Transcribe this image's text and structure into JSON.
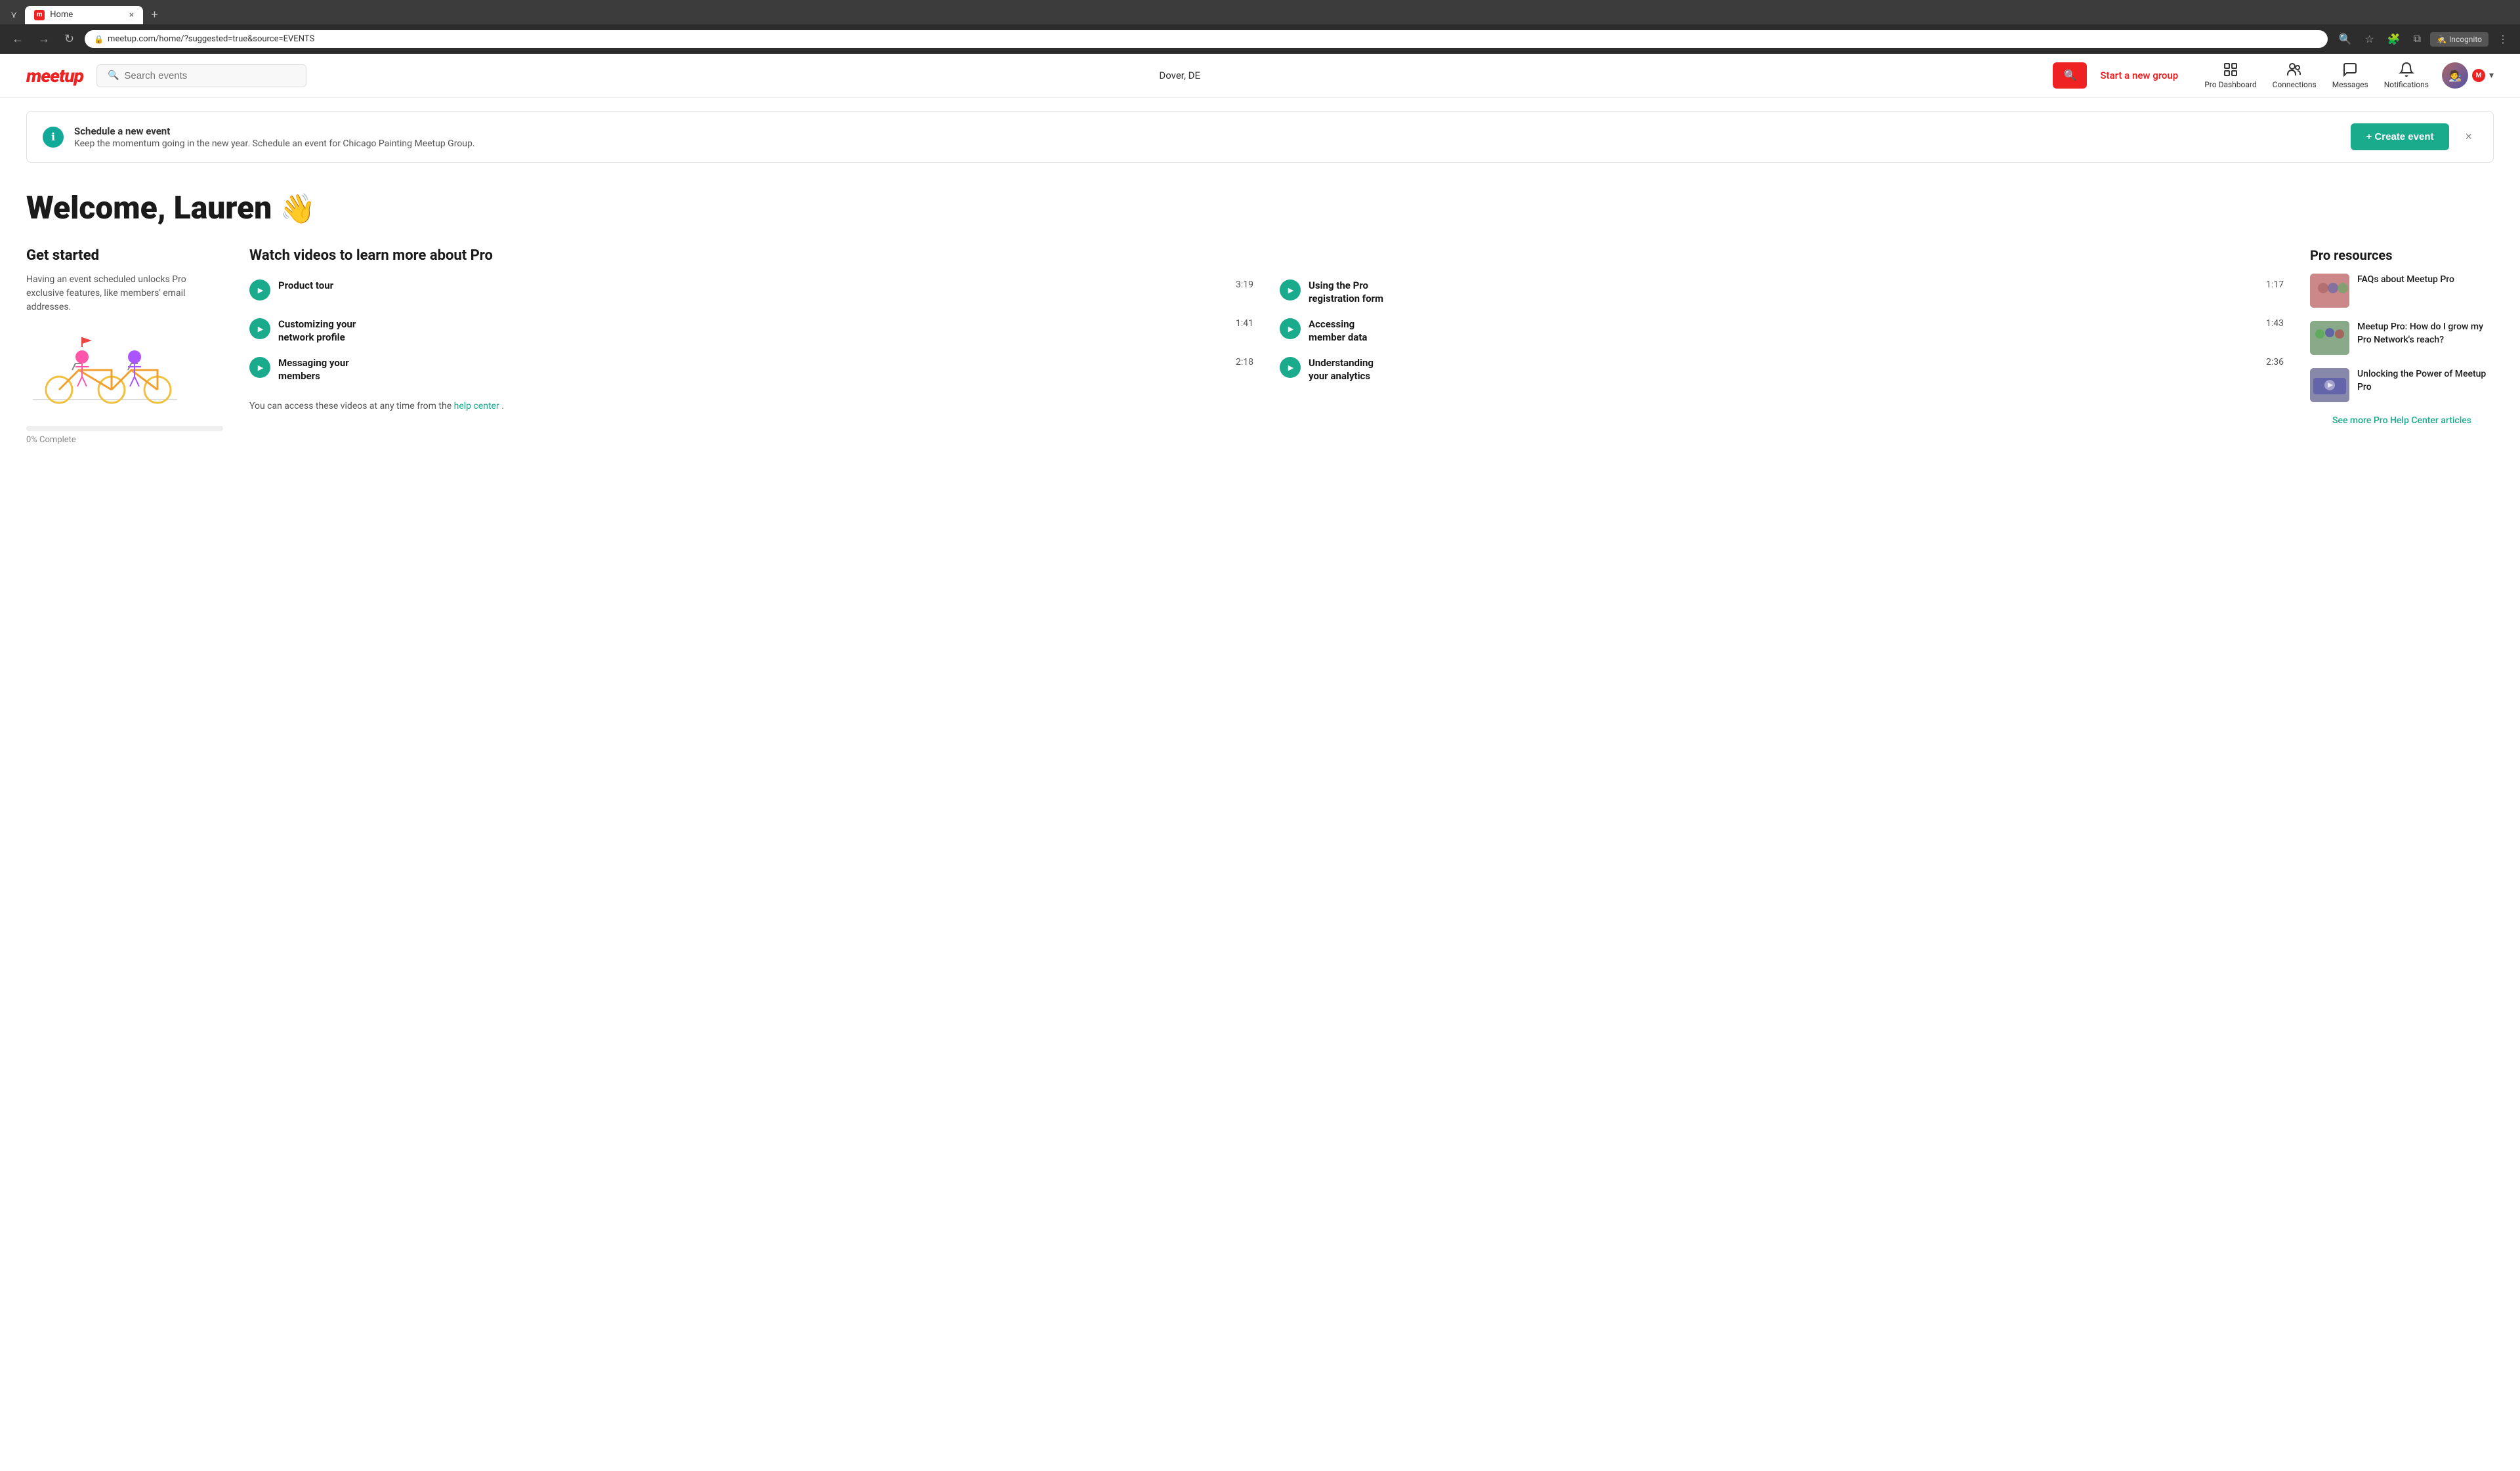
{
  "browser": {
    "tab_favicon": "m",
    "tab_title": "Home",
    "tab_close": "×",
    "new_tab": "+",
    "tab_list": "⌄",
    "nav_back": "←",
    "nav_forward": "→",
    "nav_refresh": "↻",
    "address_url": "meetup.com/home/?suggested=true&source=EVENTS",
    "toolbar_search": "🔍",
    "toolbar_bookmark": "☆",
    "toolbar_extensions": "🧩",
    "toolbar_split": "⧉",
    "incognito_label": "Incognito",
    "incognito_icon": "🕵",
    "toolbar_menu": "⋮"
  },
  "header": {
    "logo_text": "meetup",
    "search_placeholder": "Search events",
    "location": "Dover, DE",
    "search_btn_icon": "🔍",
    "start_group_label": "Start a new group",
    "nav_items": [
      {
        "id": "pro-dashboard",
        "label": "Pro Dashboard"
      },
      {
        "id": "connections",
        "label": "Connections"
      },
      {
        "id": "messages",
        "label": "Messages"
      },
      {
        "id": "notifications",
        "label": "Notifications"
      }
    ],
    "avatar_emoji": "👤",
    "chevron": "▾"
  },
  "banner": {
    "icon": "ℹ",
    "title": "Schedule a new event",
    "description": "Keep the momentum going in the new year. Schedule an event for Chicago Painting Meetup Group.",
    "create_btn_label": "+ Create event",
    "close_icon": "×"
  },
  "main": {
    "welcome_heading": "Welcome, Lauren",
    "wave_emoji": "👋",
    "get_started": {
      "heading": "Get started",
      "description": "Having an event scheduled unlocks Pro exclusive features, like members' email addresses.",
      "progress_pct": 0,
      "progress_label": "0% Complete"
    },
    "videos": {
      "heading": "Watch videos to learn more about Pro",
      "items": [
        {
          "title": "Product tour",
          "duration": "3:19"
        },
        {
          "title": "Using the Pro registration form",
          "duration": "1:17"
        },
        {
          "title": "Customizing your network profile",
          "duration": "1:41"
        },
        {
          "title": "Accessing member data",
          "duration": "1:43"
        },
        {
          "title": "Messaging your members",
          "duration": "2:18"
        },
        {
          "title": "Understanding your analytics",
          "duration": "2:36"
        }
      ],
      "access_note_prefix": "You can access these videos at any time from the ",
      "help_link_text": "help center",
      "access_note_suffix": "."
    },
    "pro_resources": {
      "heading": "Pro resources",
      "items": [
        {
          "thumb_class": "resource-thumb-1",
          "text": "FAQs about Meetup Pro"
        },
        {
          "thumb_class": "resource-thumb-2",
          "text": "Meetup Pro: How do I grow my Pro Network's reach?"
        },
        {
          "thumb_class": "resource-thumb-3",
          "text": "Unlocking the Power of Meetup Pro"
        }
      ],
      "see_more_label": "See more Pro Help Center articles"
    }
  }
}
